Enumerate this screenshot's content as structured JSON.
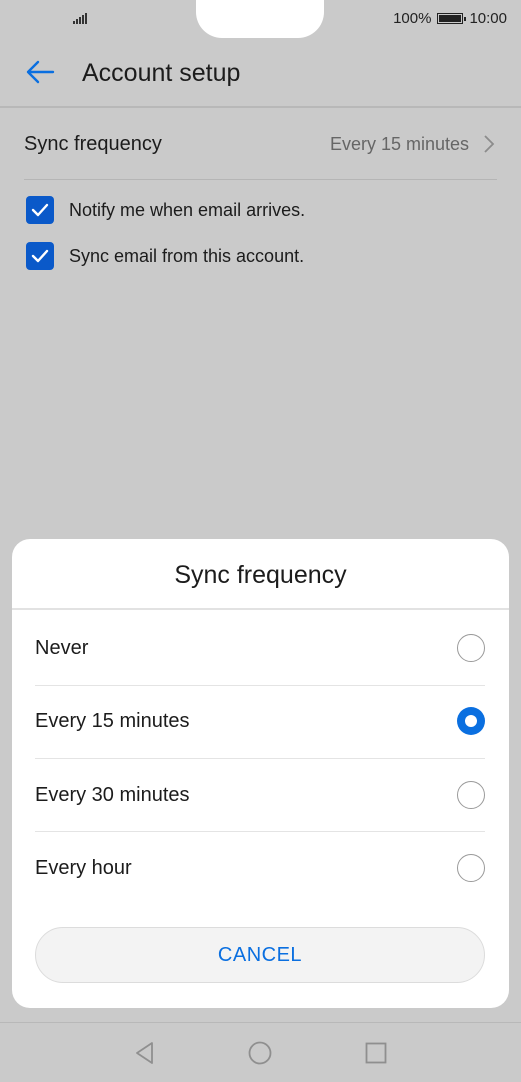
{
  "status_bar": {
    "battery_percent": "100%",
    "time": "10:00",
    "signal_icon": "signal-icon",
    "battery_icon": "battery-icon"
  },
  "header": {
    "title": "Account setup",
    "back_icon": "arrow-left-icon"
  },
  "settings": {
    "sync_frequency": {
      "label": "Sync frequency",
      "value": "Every 15 minutes"
    },
    "checkboxes": [
      {
        "label": "Notify me when email arrives.",
        "checked": true
      },
      {
        "label": "Sync email from this account.",
        "checked": true
      }
    ]
  },
  "dialog": {
    "title": "Sync frequency",
    "options": [
      {
        "label": "Never",
        "selected": false
      },
      {
        "label": "Every 15 minutes",
        "selected": true
      },
      {
        "label": "Every 30 minutes",
        "selected": false
      },
      {
        "label": "Every hour",
        "selected": false
      }
    ],
    "cancel_label": "CANCEL"
  },
  "colors": {
    "accent": "#0a6fe0",
    "checkbox": "#0a59c9",
    "scrim_background": "#cacaca"
  }
}
